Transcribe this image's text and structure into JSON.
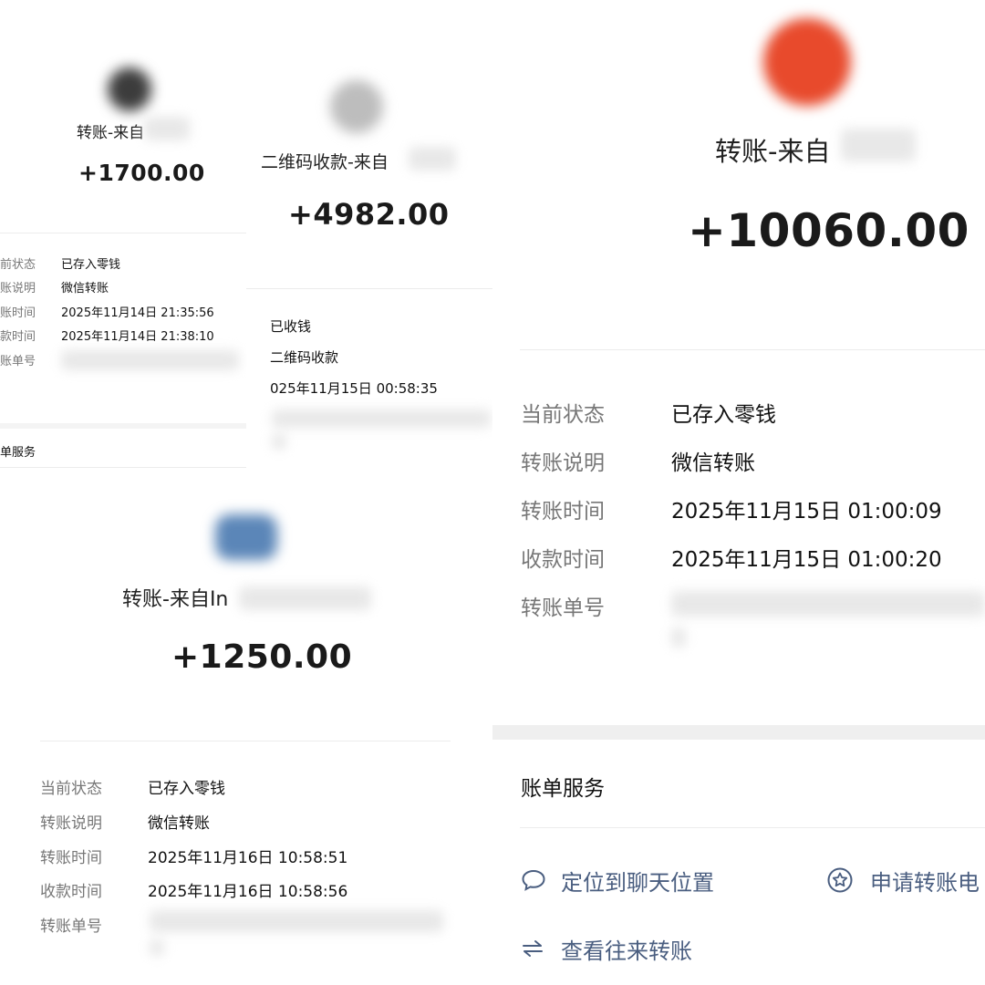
{
  "panel_a": {
    "title": "转账-来自",
    "amount": "+1700.00",
    "rows": [
      {
        "label": "前状态",
        "value": "已存入零钱"
      },
      {
        "label": "账说明",
        "value": "微信转账"
      },
      {
        "label": "账时间",
        "value": "2025年11月14日 21:35:56"
      },
      {
        "label": "款时间",
        "value": "2025年11月14日 21:38:10"
      },
      {
        "label": "账单号",
        "value": ""
      }
    ],
    "service_title": "单服务"
  },
  "panel_b": {
    "title": "二维码收款-来自",
    "amount": "+4982.00",
    "rows": [
      {
        "value": "已收钱"
      },
      {
        "value": "二维码收款"
      },
      {
        "value": "025年11月15日 00:58:35"
      }
    ]
  },
  "panel_c": {
    "title": "转账-来自In",
    "amount": "+1250.00",
    "rows": [
      {
        "label": "当前状态",
        "value": "已存入零钱"
      },
      {
        "label": "转账说明",
        "value": "微信转账"
      },
      {
        "label": "转账时间",
        "value": "2025年11月16日 10:58:51"
      },
      {
        "label": "收款时间",
        "value": "2025年11月16日 10:58:56"
      },
      {
        "label": "转账单号",
        "value": ""
      }
    ]
  },
  "panel_d": {
    "title": "转账-来自",
    "amount": "+10060.00",
    "rows": [
      {
        "label": "当前状态",
        "value": "已存入零钱"
      },
      {
        "label": "转账说明",
        "value": "微信转账"
      },
      {
        "label": "转账时间",
        "value": "2025年11月15日 01:00:09"
      },
      {
        "label": "收款时间",
        "value": "2025年11月15日 01:00:20"
      },
      {
        "label": "转账单号",
        "value": ""
      }
    ],
    "service_title": "账单服务",
    "actions": {
      "locate_chat": "定位到聊天位置",
      "apply_receipt": "申请转账电",
      "view_transfers": "查看往来转账"
    },
    "colors": {
      "action_text": "#4a5e80",
      "divider": "#ececec",
      "label": "#777777"
    }
  }
}
